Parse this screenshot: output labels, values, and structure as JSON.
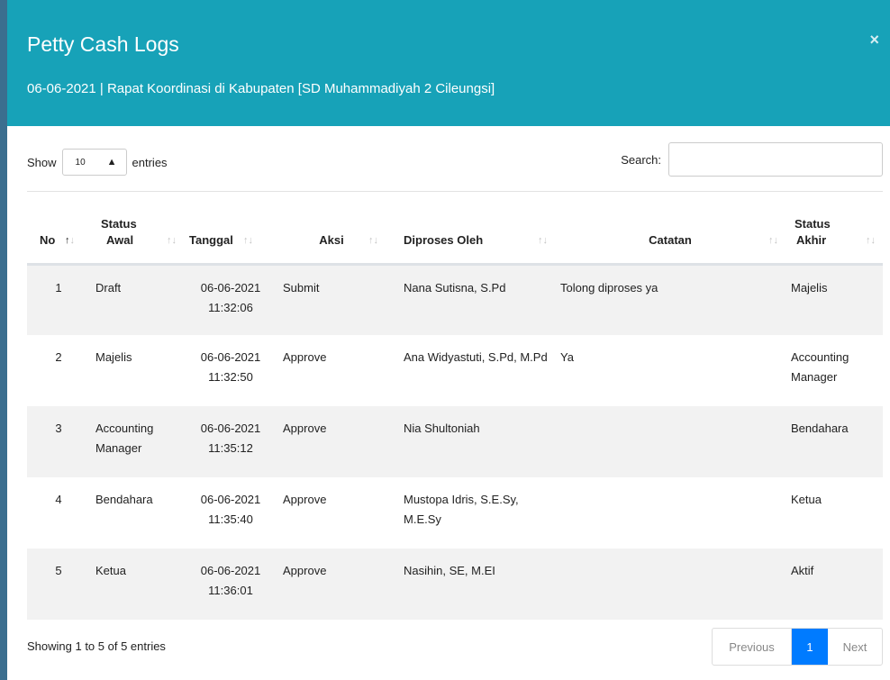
{
  "modal": {
    "title": "Petty Cash Logs",
    "subtitle": "06-06-2021 | Rapat Koordinasi di Kabupaten [SD Muhammadiyah 2 Cileungsi]",
    "close_icon": "×"
  },
  "length": {
    "show_label": "Show",
    "value": "10",
    "entries_label": "entries"
  },
  "search": {
    "label": "Search:",
    "value": "",
    "placeholder": ""
  },
  "columns": {
    "no": "No",
    "status_awal_1": "Status",
    "status_awal_2": "Awal",
    "tanggal": "Tanggal",
    "aksi": "Aksi",
    "diproses_oleh": "Diproses Oleh",
    "catatan": "Catatan",
    "status_akhir_1": "Status",
    "status_akhir_2": "Akhir"
  },
  "rows": [
    {
      "no": "1",
      "status_awal": "Draft",
      "tanggal_date": "06-06-2021",
      "tanggal_time": "11:32:06",
      "aksi": "Submit",
      "diproses_oleh": "Nana Sutisna, S.Pd",
      "catatan": "Tolong diproses ya",
      "status_akhir": "Majelis"
    },
    {
      "no": "2",
      "status_awal": "Majelis",
      "tanggal_date": "06-06-2021",
      "tanggal_time": "11:32:50",
      "aksi": "Approve",
      "diproses_oleh": "Ana Widyastuti, S.Pd, M.Pd",
      "catatan": "Ya",
      "status_akhir": "Accounting Manager"
    },
    {
      "no": "3",
      "status_awal": "Accounting Manager",
      "tanggal_date": "06-06-2021",
      "tanggal_time": "11:35:12",
      "aksi": "Approve",
      "diproses_oleh": "Nia Shultoniah",
      "catatan": "",
      "status_akhir": "Bendahara"
    },
    {
      "no": "4",
      "status_awal": "Bendahara",
      "tanggal_date": "06-06-2021",
      "tanggal_time": "11:35:40",
      "aksi": "Approve",
      "diproses_oleh": "Mustopa Idris, S.E.Sy, M.E.Sy",
      "catatan": "",
      "status_akhir": "Ketua"
    },
    {
      "no": "5",
      "status_awal": "Ketua",
      "tanggal_date": "06-06-2021",
      "tanggal_time": "11:36:01",
      "aksi": "Approve",
      "diproses_oleh": "Nasihin, SE, M.EI",
      "catatan": "",
      "status_akhir": "Aktif"
    }
  ],
  "footer": {
    "info": "Showing 1 to 5 of 5 entries",
    "previous": "Previous",
    "page": "1",
    "next": "Next"
  },
  "colors": {
    "header_bg": "#17a2b8",
    "active_page": "#007bff",
    "stripe": "#f2f2f2"
  }
}
